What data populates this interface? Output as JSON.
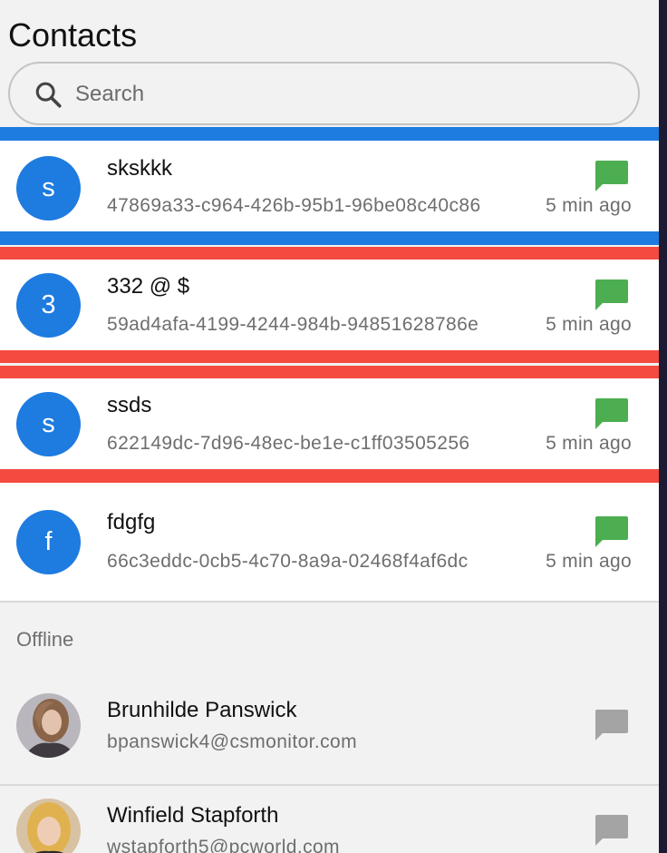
{
  "app": {
    "title": "Contacts",
    "search": {
      "placeholder": "Search",
      "value": ""
    }
  },
  "colors": {
    "highlight_blue": "#1e7be0",
    "highlight_red": "#f44b40",
    "avatar_blue": "#1e7be0",
    "chat_online": "#4cae50",
    "chat_offline": "#a4a4a4"
  },
  "online": [
    {
      "initial": "s",
      "name": "skskkk",
      "id": "47869a33-c964-426b-95b1-96be08c40c86",
      "time": "5 min ago"
    },
    {
      "initial": "3",
      "name": "332 @ $",
      "id": "59ad4afa-4199-4244-984b-94851628786e",
      "time": "5 min ago"
    },
    {
      "initial": "s",
      "name": "ssds",
      "id": "622149dc-7d96-48ec-be1e-c1ff03505256",
      "time": "5 min ago"
    },
    {
      "initial": "f",
      "name": "fdgfg",
      "id": "66c3eddc-0cb5-4c70-8a9a-02468f4af6dc",
      "time": "5 min ago"
    }
  ],
  "offline_label": "Offline",
  "offline": [
    {
      "name": "Brunhilde Panswick",
      "email": "bpanswick4@csmonitor.com",
      "photo_icon": "avatar-photo"
    },
    {
      "name": "Winfield Stapforth",
      "email": "wstapforth5@pcworld.com",
      "photo_icon": "avatar-photo"
    }
  ]
}
